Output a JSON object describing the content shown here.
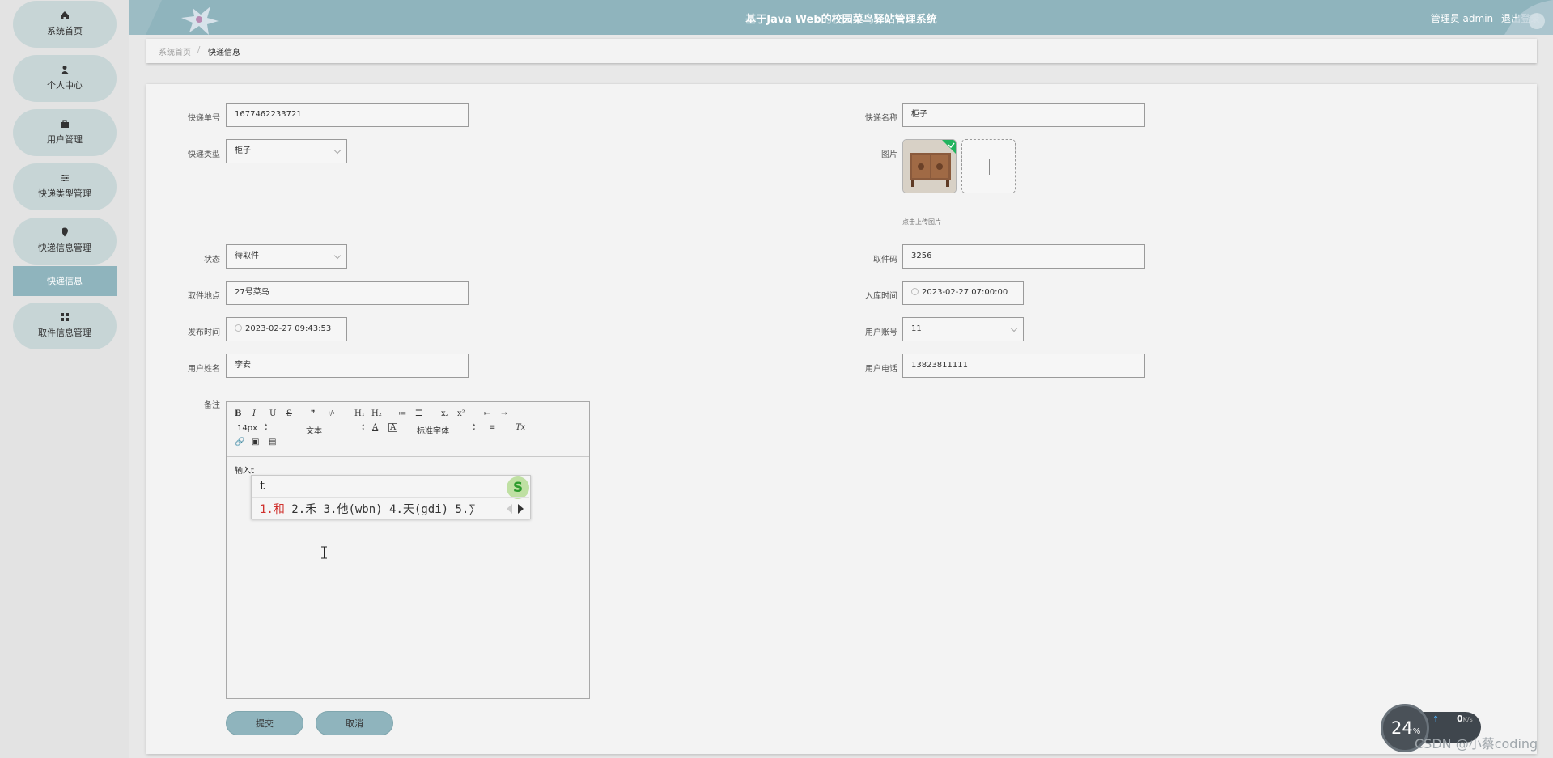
{
  "app": {
    "title": "基于Java Web的校园菜鸟驿站管理系统",
    "user_label": "管理员 admin",
    "logout_label": "退出登录"
  },
  "sidebar": {
    "items": [
      {
        "label": "系统首页",
        "icon": "home-icon"
      },
      {
        "label": "个人中心",
        "icon": "user-icon"
      },
      {
        "label": "用户管理",
        "icon": "briefcase-icon"
      },
      {
        "label": "快递类型管理",
        "icon": "sliders-icon"
      },
      {
        "label": "快递信息管理",
        "icon": "location-pin-icon"
      },
      {
        "label": "取件信息管理",
        "icon": "grid-icon"
      }
    ],
    "active_sub": "快递信息"
  },
  "breadcrumb": {
    "home": "系统首页",
    "separator": "/",
    "current": "快递信息"
  },
  "form": {
    "tracking_no": {
      "label": "快递单号",
      "value": "1677462233721"
    },
    "express_name": {
      "label": "快递名称",
      "value": "柜子"
    },
    "express_type": {
      "label": "快递类型",
      "value": "柜子"
    },
    "image": {
      "label": "图片",
      "hint": "点击上传图片"
    },
    "status": {
      "label": "状态",
      "value": "待取件"
    },
    "pickup_code": {
      "label": "取件码",
      "value": "3256"
    },
    "pickup_location": {
      "label": "取件地点",
      "value": "27号菜鸟"
    },
    "stock_in_time": {
      "label": "入库时间",
      "value": "2023-02-27 07:00:00"
    },
    "publish_time": {
      "label": "发布时间",
      "value": "2023-02-27 09:43:53"
    },
    "user_account": {
      "label": "用户账号",
      "value": "11"
    },
    "user_name": {
      "label": "用户姓名",
      "value": "李安"
    },
    "user_phone": {
      "label": "用户电话",
      "value": "13823811111"
    },
    "remark": {
      "label": "备注",
      "content": "输入t"
    }
  },
  "editor_toolbar": {
    "bold": "B",
    "italic": "I",
    "underline": "U",
    "strike": "S",
    "quote": "❞",
    "code": "‹/›",
    "h1": "H₁",
    "h2": "H₂",
    "ordered_list": "≔",
    "bullet_list": "☰",
    "sub": "x₂",
    "sup": "x²",
    "outdent": "⇤",
    "indent": "⇥",
    "font_size": "14px",
    "block_type": "文本",
    "font_color": "A",
    "bg_color": "A",
    "font_family": "标准字体",
    "align": "≡",
    "clear_format": "Tx",
    "link": "🔗",
    "image": "▣",
    "video": "▤"
  },
  "ime": {
    "input": "t",
    "candidates": [
      {
        "index": "1.",
        "text": "和"
      },
      {
        "index": "2.",
        "text": "禾"
      },
      {
        "index": "3.",
        "text": "他(wbn)"
      },
      {
        "index": "4.",
        "text": "天(gdi)"
      },
      {
        "index": "5.",
        "text": "∑"
      }
    ],
    "logo": "S"
  },
  "buttons": {
    "submit": "提交",
    "cancel": "取消"
  },
  "overlay": {
    "cpu_percent": "24",
    "cpu_unit": "%",
    "net_speed": "0",
    "net_unit": "K/s",
    "watermark": "CSDN @小蔡coding"
  },
  "colors": {
    "accent": "#8fb4bd",
    "submenu_active": "#8fb4bd",
    "menu_pill": "#c7d5d6"
  }
}
